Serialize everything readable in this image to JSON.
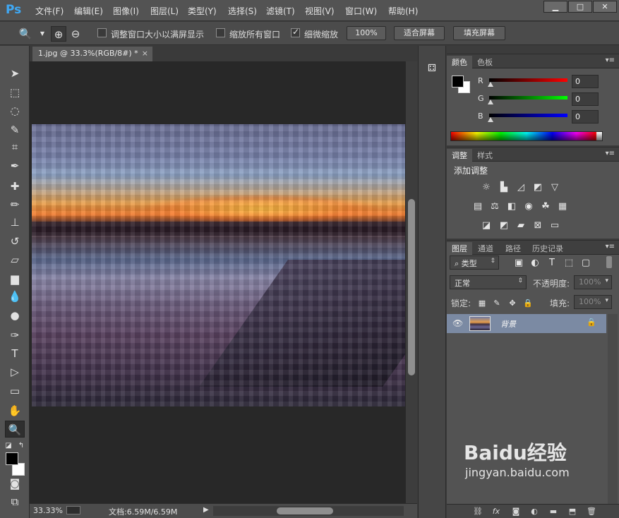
{
  "app": {
    "logo": "Ps"
  },
  "menu": [
    "文件(F)",
    "编辑(E)",
    "图像(I)",
    "图层(L)",
    "类型(Y)",
    "选择(S)",
    "滤镜(T)",
    "视图(V)",
    "窗口(W)",
    "帮助(H)"
  ],
  "window_controls": {
    "minimize": "▁",
    "maximize": "□",
    "close": "✕"
  },
  "options": {
    "resize_windows": "调整窗口大小以满屏显示",
    "zoom_all": "缩放所有窗口",
    "scrubby": "细微缩放",
    "scrubby_checked": true,
    "resize_checked": false,
    "zoom_all_checked": false,
    "btn_100": "100%",
    "btn_fit": "适合屏幕",
    "btn_fill": "填充屏幕"
  },
  "document": {
    "tab_title": "1.jpg @ 33.3%(RGB/8#) *",
    "tab_close": "×",
    "zoom": "33.33%",
    "doc_info": "文档:6.59M/6.59M"
  },
  "color_panel": {
    "tabs": [
      "颜色",
      "色板"
    ],
    "r_label": "R",
    "g_label": "G",
    "b_label": "B",
    "r": "0",
    "g": "0",
    "b": "0",
    "fg_color": "#000000",
    "bg_color": "#ffffff"
  },
  "adjust_panel": {
    "tabs": [
      "调整",
      "样式"
    ],
    "title": "添加调整"
  },
  "layers_panel": {
    "tabs": [
      "图层",
      "通道",
      "路径",
      "历史记录"
    ],
    "filter": "类型",
    "blend_mode": "正常",
    "opacity_label": "不透明度:",
    "opacity": "100%",
    "lock_label": "锁定:",
    "fill_label": "填充:",
    "fill": "100%",
    "layer_name": "背景"
  },
  "watermark": {
    "brand": "Baidu经验",
    "url": "jingyan.baidu.com"
  }
}
